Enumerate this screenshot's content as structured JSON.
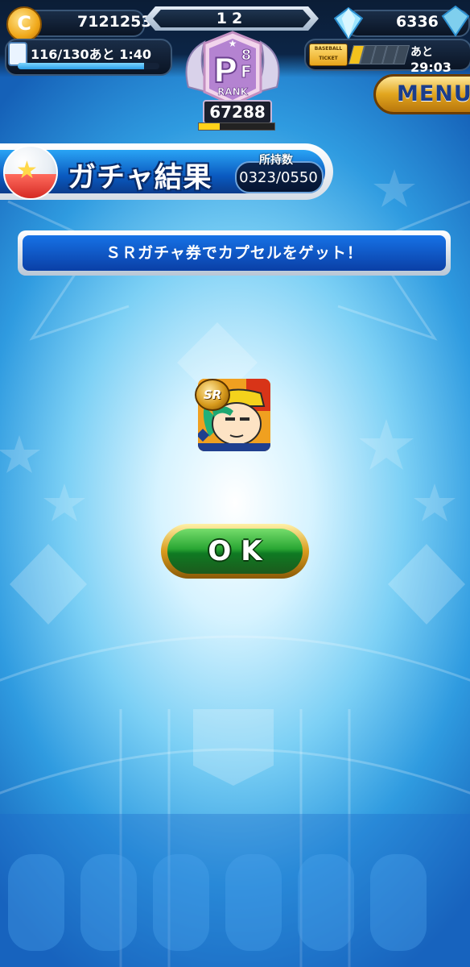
{
  "header": {
    "coins": "7121253",
    "center_value": "12",
    "gems": "6336",
    "stamina_text": "116/130あと 1:40",
    "stamina_fraction": 0.89,
    "ticket_label_1": "BASEBALL",
    "ticket_label_2": "TICKET",
    "ticket_timer_prefix": "あと",
    "ticket_timer": "29:03",
    "rank_emblem_top": "8",
    "rank_emblem_letter_1": "P",
    "rank_emblem_letter_2": "F",
    "rank_label": "RANK",
    "rank_value": "67288",
    "rank_progress_fraction": 0.28
  },
  "menu": {
    "label": "MENU"
  },
  "banner": {
    "title": "ガチャ結果",
    "count_label": "所持数",
    "count_value": "0323/0550"
  },
  "message": {
    "text": "ＳＲガチャ券でカプセルをゲット！"
  },
  "reward": {
    "badge": "SR"
  },
  "ok_button": {
    "label": "OK"
  },
  "colors": {
    "accent_blue": "#0a5ac0",
    "ok_green": "#2aa633",
    "gold": "#d89b1d"
  }
}
